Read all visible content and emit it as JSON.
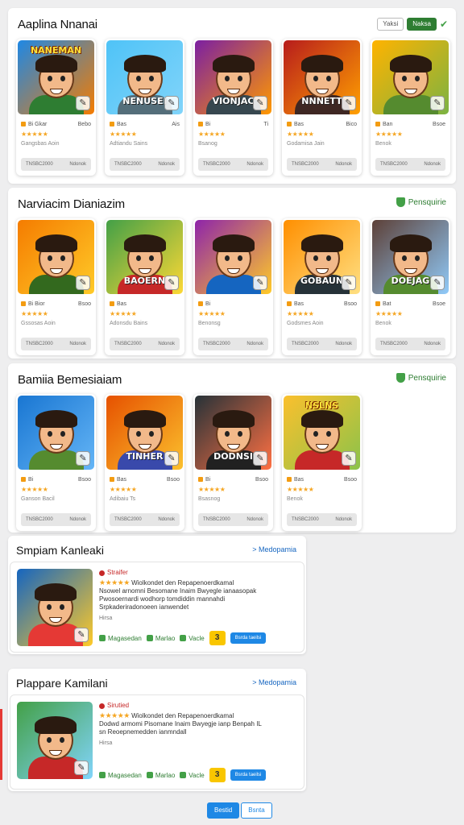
{
  "sections": [
    {
      "title": "Aaplina Nnanai",
      "toggles": [
        "Yaksi",
        "Naksa"
      ],
      "cards": [
        {
          "art_label": "NANEMAN",
          "art_label_pos": "top",
          "bg": "#1e88e5",
          "bg2": "#f57c00",
          "shirt": "#2e7d32",
          "tag": "Bi Gkar",
          "num": "Bebo",
          "sub": "Gangsbas Aoin",
          "btn_l": "TNSBC2000",
          "btn_r": "Ndonok"
        },
        {
          "art_label": "NENUSEI",
          "art_label_pos": "bottom",
          "bg": "#4fc3f7",
          "bg2": "#81d4fa",
          "shirt": "#546e7a",
          "tag": "Bas",
          "num": "Ais",
          "sub": "Adtiandu Sains",
          "btn_l": "TNSBC2000",
          "btn_r": "Ndonok"
        },
        {
          "art_label": "VIONJAC",
          "art_label_pos": "bottom",
          "bg": "#7b1fa2",
          "bg2": "#ff9800",
          "shirt": "#37474f",
          "tag": "Bi",
          "num": "Ti",
          "sub": "Bsanog",
          "btn_l": "TNSBC2000",
          "btn_r": "Ndonok"
        },
        {
          "art_label": "NNNETT",
          "art_label_pos": "bottom",
          "bg": "#b71c1c",
          "bg2": "#ffa000",
          "shirt": "#3e2723",
          "tag": "Bas",
          "num": "Bico",
          "sub": "Godamisa Jain",
          "btn_l": "TNSBC2000",
          "btn_r": "Ndonok"
        },
        {
          "art_label": "",
          "art_label_pos": "top",
          "bg": "#ffb300",
          "bg2": "#7cb342",
          "shirt": "#558b2f",
          "tag": "Ban",
          "num": "Bsoe",
          "sub": "Benok",
          "btn_l": "TNSBC2000",
          "btn_r": "Ndonok"
        }
      ]
    },
    {
      "title": "Narviacim Dianiazim",
      "action": "Pensquirie",
      "cards": [
        {
          "art_label": "",
          "art_label_pos": "top",
          "bg": "#f57c00",
          "bg2": "#ffca28",
          "shirt": "#33691e",
          "tag": "Bi Bior",
          "num": "Bsoo",
          "sub": "Gssosas Aoin",
          "btn_l": "TNSBC2000",
          "btn_r": "Ndonok"
        },
        {
          "art_label": "BAOERN",
          "art_label_pos": "bottom",
          "bg": "#43a047",
          "bg2": "#fdd835",
          "shirt": "#c62828",
          "tag": "Bas",
          "num": "",
          "sub": "Adonsdu Bains",
          "btn_l": "TNSBC2000",
          "btn_r": "Ndonok"
        },
        {
          "art_label": "",
          "art_label_pos": "top",
          "bg": "#8e24aa",
          "bg2": "#ffca28",
          "shirt": "#1565c0",
          "tag": "Bi",
          "num": "",
          "sub": "Benonsg",
          "btn_l": "TNSBC2000",
          "btn_r": "Ndonok"
        },
        {
          "art_label": "GOBAUN",
          "art_label_pos": "bottom",
          "bg": "#ff8f00",
          "bg2": "#ffe082",
          "shirt": "#263238",
          "tag": "Bas",
          "num": "Bsoo",
          "sub": "Godsmes Aoin",
          "btn_l": "TNSBC2000",
          "btn_r": "Ndonok"
        },
        {
          "art_label": "DOEJAG",
          "art_label_pos": "bottom",
          "bg": "#5d4037",
          "bg2": "#90caf9",
          "shirt": "#558b2f",
          "tag": "Bat",
          "num": "Bsoe",
          "sub": "Benok",
          "btn_l": "TNSBC2000",
          "btn_r": "Ndonok"
        }
      ]
    },
    {
      "title": "Bamiia Bemesiaiam",
      "action": "Pensquirie",
      "cards": [
        {
          "art_label": "",
          "art_label_pos": "top",
          "bg": "#1976d2",
          "bg2": "#64b5f6",
          "shirt": "#558b2f",
          "tag": "Bi",
          "num": "Bsoo",
          "sub": "Ganson Bacil",
          "btn_l": "TNSBC2000",
          "btn_r": "Ndonok"
        },
        {
          "art_label": "TINHER",
          "art_label_pos": "bottom",
          "bg": "#e65100",
          "bg2": "#fbc02d",
          "shirt": "#3949ab",
          "tag": "Bas",
          "num": "Bsoo",
          "sub": "Adibaiu Ts",
          "btn_l": "TNSBC2000",
          "btn_r": "Ndonok"
        },
        {
          "art_label": "DODNSI",
          "art_label_pos": "bottom",
          "bg": "#263238",
          "bg2": "#ff7043",
          "shirt": "#212121",
          "tag": "Bi",
          "num": "Bsoo",
          "sub": "Bsasnog",
          "btn_l": "TNSBC2000",
          "btn_r": "Ndonok"
        },
        {
          "art_label": "NSLNS",
          "art_label_pos": "top",
          "bg": "#fbc02d",
          "bg2": "#8bc34a",
          "shirt": "#c62828",
          "tag": "Bas",
          "num": "Bsoo",
          "sub": "Benok",
          "btn_l": "TNSBC2000",
          "btn_r": "Ndonok"
        }
      ]
    }
  ],
  "recommendations": [
    {
      "title": "Smpiam Kanleaki",
      "link": "Medopamia",
      "head": "Straifer",
      "line1": "Wiolkondet den Repapenoerdkamal",
      "line2": "Nsowel arnomni Besomane Inaim Bwyegle ianaasopak",
      "line3": "Pwosoernardi wodhorp tomdiddin mannahdi",
      "line4": "Srpkaderiradonoeen ianwendet",
      "meta": "Hirsa",
      "act1": "Magasedan",
      "act2": "Marlao",
      "act3": "Vacle",
      "btn": "Bsrda taeilsi",
      "bg": "#1565c0",
      "bg2": "#ffca28",
      "shirt": "#e53935"
    },
    {
      "title": "Plappare Kamilani",
      "link": "Medopamia",
      "head": "Sirutied",
      "line1": "Wiolkondet den Repapenoerdkamal",
      "line2": "Dodwd armomi Pisomane Inaim Bwyegje ianp Benpah IL",
      "line3": "sn Reoepnemedden ianmndall",
      "line4": "",
      "meta": "Hirsa",
      "act1": "Magasedan",
      "act2": "Marlao",
      "act3": "Vacle",
      "btn": "Bsrda taeilsi",
      "bg": "#43a047",
      "bg2": "#81d4fa",
      "shirt": "#c62828"
    }
  ],
  "pager": {
    "prev": "Bestid",
    "next": "Bsnta"
  }
}
